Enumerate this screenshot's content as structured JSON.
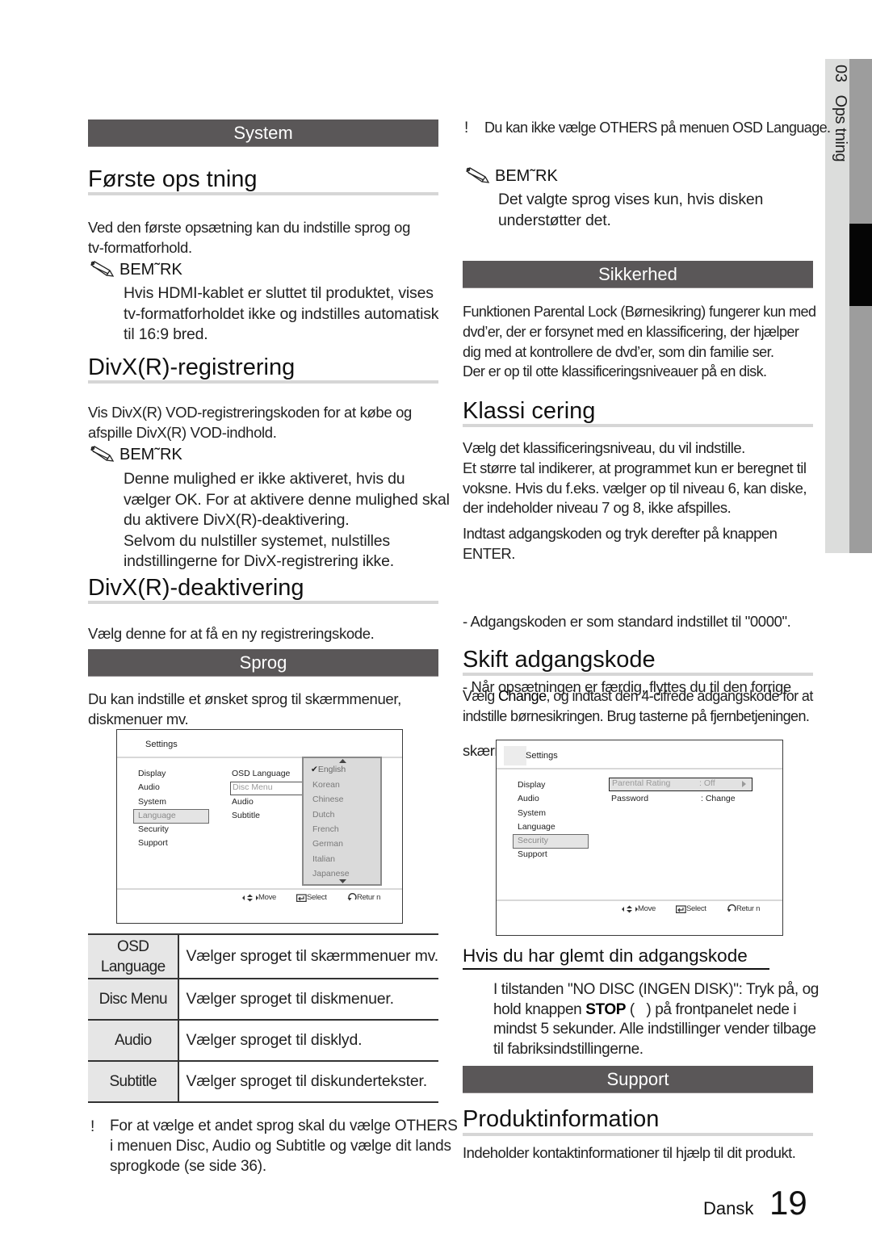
{
  "side_tab": {
    "chapter_number": "03",
    "chapter_title": "Ops tning"
  },
  "left": {
    "system_bar": "System",
    "forste": {
      "heading": "Første ops tning",
      "paragraph": [
        "Ved den første opsætning kan du indstille sprog og",
        "tv-formatforhold."
      ],
      "note_label": "BEM˜RK",
      "note": [
        "Hvis HDMI-kablet er sluttet til produktet, vises",
        "tv-formatforholdet ikke og indstilles automatisk",
        "til 16:9 bred."
      ]
    },
    "divx_reg": {
      "heading": "DivX(R)-registrering",
      "paragraph": [
        "Vis DivX(R) VOD-registreringskoden for at købe og",
        "afspille DivX(R) VOD-indhold."
      ],
      "note_label": "BEM˜RK",
      "note": [
        "Denne mulighed er ikke aktiveret, hvis du",
        "vælger OK. For at aktivere denne mulighed skal",
        "du aktivere DivX(R)-deaktivering.",
        "Selvom du nulstiller systemet, nulstilles",
        "indstillingerne for DivX-registrering ikke."
      ]
    },
    "divx_deact": {
      "heading": "DivX(R)-deaktivering",
      "paragraph": "Vælg denne for at få en ny registreringskode."
    },
    "sprog_bar": "Sprog",
    "sprog_paragraph": [
      "Du kan indstille et ønsket sprog til skærmmenuer,",
      "diskmenuer mv."
    ],
    "screen": {
      "title": "Settings",
      "menu": [
        "Display",
        "Audio",
        "System",
        "Language",
        "Security",
        "Support"
      ],
      "menu_selected": "Language",
      "submenu": [
        "OSD Language",
        "Disc Menu",
        "Audio",
        "Subtitle"
      ],
      "submenu_selected": "Disc Menu",
      "dropdown_options": [
        "English",
        "Korean",
        "Chinese",
        "Dutch",
        "French",
        "German",
        "Italian",
        "Japanese"
      ],
      "dropdown_checked": "English",
      "footer": {
        "move": "Move",
        "select": "Select",
        "return": "Retur n"
      }
    },
    "table": [
      {
        "key": [
          "OSD",
          "Language"
        ],
        "value": "Vælger sproget til skærmmenuer mv."
      },
      {
        "key": [
          "Disc Menu"
        ],
        "value": "Vælger sproget til diskmenuer."
      },
      {
        "key": [
          "Audio"
        ],
        "value": "Vælger sproget til disklyd."
      },
      {
        "key": [
          "Subtitle"
        ],
        "value": "Vælger sproget til diskundertekster."
      }
    ],
    "bottom_note": {
      "bang": "!",
      "lines": [
        "For at vælge et andet sprog skal du vælge OTHERS",
        "i menuen Disc, Audio og Subtitle og vælge dit lands",
        "sprogkode (se side 36)."
      ]
    }
  },
  "right": {
    "top_note": {
      "bang": "!",
      "text": "Du kan ikke vælge OTHERS på menuen OSD Language."
    },
    "note_label": "BEM˜RK",
    "note": [
      "Det valgte sprog vises kun, hvis disken",
      "understøtter det."
    ],
    "sikkerhed_bar": "Sikkerhed",
    "sikkerhed_paragraph": [
      "Funktionen Parental Lock (Børnesikring) fungerer kun med",
      "dvd’er, der er forsynet med en klassificering, der hjælper",
      "dig med at kontrollere de dvd’er, som din familie ser.",
      "Der er op til otte klassificeringsniveauer på en disk."
    ],
    "klass": {
      "heading": "Klassi cering",
      "paragraph": [
        "Vælg det klassificeringsniveau, du vil indstille.",
        "Et større tal indikerer, at programmet kun er beregnet til",
        "voksne. Hvis du f.eks. vælger op til niveau 6, kan diske,",
        "der indeholder niveau 7 og 8, ikke afspilles."
      ],
      "enter_paragraph": [
        "Indtast adgangskoden og tryk derefter på knappen",
        "ENTER."
      ],
      "bullets": [
        "- Adgangskoden er som standard indstillet til \"0000\".",
        "- Når opsætningen er færdig, flyttes du til den forrige",
        "  skærm."
      ]
    },
    "skift": {
      "heading": "Skift adgangskode",
      "paragraph_pre": "Vælg ",
      "paragraph_bold": "Change",
      "paragraph_post": ", og indtast den 4-cifrede adgangskode for at",
      "paragraph_line2": "indstille børnesikringen. Brug tasterne på fjernbetjeningen."
    },
    "screen": {
      "title": "Settings",
      "menu": [
        "Display",
        "Audio",
        "System",
        "Language",
        "Security",
        "Support"
      ],
      "menu_selected": "Security",
      "rows": [
        {
          "label": "Parental Rating",
          "value": ": Off",
          "selected": true
        },
        {
          "label": "Password",
          "value": ": Change",
          "selected": false
        }
      ],
      "footer": {
        "move": "Move",
        "select": "Select",
        "return": "Retur n"
      }
    },
    "forgot": {
      "heading": "Hvis du har glemt din adgangskode",
      "line1": "I tilstanden \"NO DISC (INGEN DISK)\": Tryk på, og",
      "line2_pre": "hold knappen ",
      "line2_bold": "STOP",
      "line2_post": " (   ) på frontpanelet nede i",
      "line3": "mindst 5 sekunder. Alle indstillinger vender tilbage",
      "line4": "til fabriksindstillingerne."
    },
    "support_bar": "Support",
    "produkt": {
      "heading": "Produktinformation",
      "paragraph": "Indeholder kontaktinformationer til hjælp til dit produkt."
    }
  },
  "footer": {
    "language": "Dansk",
    "page_number": "19"
  },
  "colors": {
    "section_bar": "#5a5758",
    "heading_rule": "#d6d6d6",
    "side_tab_light": "#dcdddc",
    "side_tab_dark": "#9d9d9d",
    "side_tab_active": "#050505",
    "table_key_bg": "#e6e6e6"
  }
}
